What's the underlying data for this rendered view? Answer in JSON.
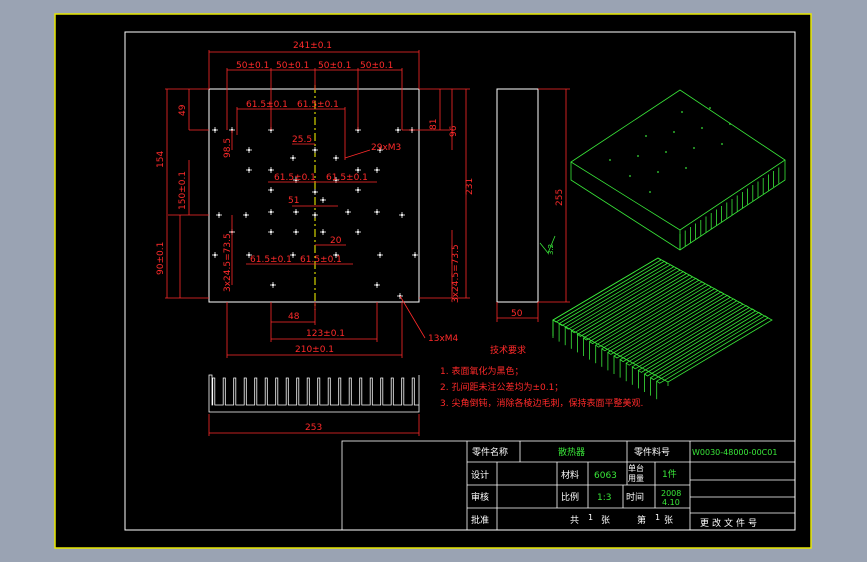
{
  "dimensions": {
    "top_total": "241±0.1",
    "top_row": [
      "50±0.1",
      "50±0.1",
      "50±0.1",
      "50±0.1"
    ],
    "second_row": [
      "61.5±0.1",
      "61.5±0.1"
    ],
    "small_25": "25.5",
    "holes_m3": "29xM3",
    "inner_row": [
      "61.5±0.1",
      "61.5±0.1"
    ],
    "dim_51": "51",
    "dim_20": "20",
    "lower_row": [
      "61.5±0.1",
      "61.5±0.1"
    ],
    "left_49": "49",
    "left_98": "98.5",
    "left_154": "154",
    "left_150": "150±0.1",
    "left_90": "90±0.1",
    "left_pitch": "3x24.5=73.5",
    "right_81": "81",
    "right_96": "96",
    "right_231": "231",
    "right_pitch": "3x24.5=73.5",
    "bottom_48": "48",
    "bottom_123": "123±0.1",
    "bottom_210": "210±0.1",
    "holes_m4": "13xM4",
    "side_height": "255",
    "side_width": "50",
    "front_width": "253",
    "roughness": "3.2"
  },
  "notes": {
    "title": "技术要求",
    "items": [
      "1. 表面氧化为黑色；",
      "2. 孔间距未注公差均为±0.1；",
      "3. 尖角倒钝，消除各棱边毛刺，保持表面平整美观."
    ]
  },
  "title_block": {
    "part_name_label": "零件名称",
    "part_name": "散热器",
    "part_no_label": "零件料号",
    "part_no": "W0030-48000-00C01",
    "design_label": "设计",
    "material_label": "材料",
    "material": "6063",
    "qty_label_1": "单台",
    "qty_label_2": "用量",
    "qty": "1件",
    "review_label": "审核",
    "scale_label": "比例",
    "scale": "1:3",
    "time_label": "时间",
    "time_1": "2008",
    "time_2": "4.10",
    "approve_label": "批准",
    "total_label": "共",
    "total_sheets": "1",
    "sheet_unit_1": "张",
    "sheet_label": "第",
    "sheet_no": "1",
    "sheet_unit_2": "张",
    "change_doc": "更改文件号"
  },
  "colors": {
    "background": "#9aa3b3",
    "paper": "#000000",
    "border": "#ffffff",
    "dimension": "#ff2a2a",
    "center_line": "#ffff00",
    "model": "#39e639"
  }
}
